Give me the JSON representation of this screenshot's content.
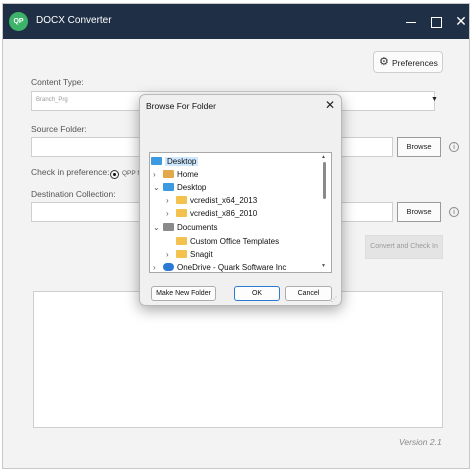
{
  "app": {
    "logo_text": "QP",
    "title": "DOCX Converter"
  },
  "toolbar": {
    "preferences_label": "Preferences"
  },
  "form": {
    "content_type_label": "Content Type:",
    "content_type_value": "Branch_Prg",
    "source_folder_label": "Source Folder:",
    "browse_label": "Browse",
    "check_in_label": "Check in preference:",
    "check_in_option": "QPP N",
    "destination_label": "Destination Collection:",
    "convert_label": "Convert and Check In",
    "info_glyph": "i"
  },
  "footer": {
    "version": "Version 2.1"
  },
  "dialog": {
    "title": "Browse For Folder",
    "tree": [
      {
        "label": "Desktop",
        "icon": "desktop-folder-icon",
        "chevron": ""
      },
      {
        "label": "Home",
        "icon": "home-icon",
        "chevron": "›"
      },
      {
        "label": "Desktop",
        "icon": "desktop-folder-icon",
        "chevron": "⌄"
      },
      {
        "label": "vcredist_x64_2013",
        "icon": "folder-icon",
        "chevron": "›"
      },
      {
        "label": "vcredist_x86_2010",
        "icon": "folder-icon",
        "chevron": "›"
      },
      {
        "label": "Documents",
        "icon": "documents-folder-icon",
        "chevron": "⌄"
      },
      {
        "label": "Custom Office Templates",
        "icon": "folder-icon",
        "chevron": ""
      },
      {
        "label": "Snagit",
        "icon": "folder-icon",
        "chevron": "›"
      },
      {
        "label": "OneDrive - Quark Software Inc",
        "icon": "onedrive-cloud-icon",
        "chevron": "›"
      }
    ],
    "make_new_folder_label": "Make New Folder",
    "ok_label": "OK",
    "cancel_label": "Cancel"
  },
  "colors": {
    "titlebar": "#1f2f45",
    "logo": "#3db36a",
    "selection": "#cde8ff",
    "ok_border": "#2b79d2"
  }
}
